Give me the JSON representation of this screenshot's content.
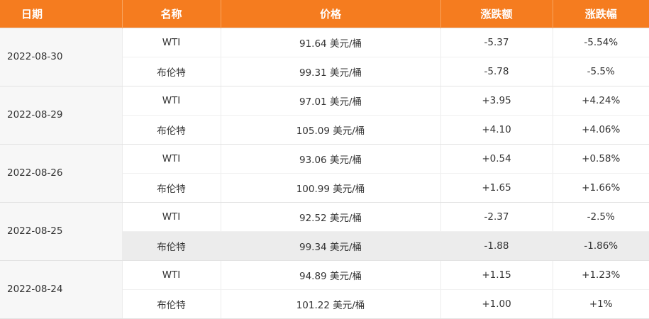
{
  "header": {
    "date": "日期",
    "name": "名称",
    "price": "价格",
    "change": "涨跌额",
    "change_pct": "涨跌幅"
  },
  "rows": [
    {
      "date": "2022-08-30",
      "items": [
        {
          "name": "WTI",
          "price": "91.64 美元/桶",
          "change": "-5.37",
          "change_pct": "-5.54%"
        },
        {
          "name": "布伦特",
          "price": "99.31 美元/桶",
          "change": "-5.78",
          "change_pct": "-5.5%"
        }
      ]
    },
    {
      "date": "2022-08-29",
      "items": [
        {
          "name": "WTI",
          "price": "97.01 美元/桶",
          "change": "+3.95",
          "change_pct": "+4.24%"
        },
        {
          "name": "布伦特",
          "price": "105.09 美元/桶",
          "change": "+4.10",
          "change_pct": "+4.06%"
        }
      ]
    },
    {
      "date": "2022-08-26",
      "items": [
        {
          "name": "WTI",
          "price": "93.06 美元/桶",
          "change": "+0.54",
          "change_pct": "+0.58%"
        },
        {
          "name": "布伦特",
          "price": "100.99 美元/桶",
          "change": "+1.65",
          "change_pct": "+1.66%"
        }
      ]
    },
    {
      "date": "2022-08-25",
      "items": [
        {
          "name": "WTI",
          "price": "92.52 美元/桶",
          "change": "-2.37",
          "change_pct": "-2.5%"
        },
        {
          "name": "布伦特",
          "price": "99.34 美元/桶",
          "change": "-1.88",
          "change_pct": "-1.86%"
        }
      ]
    },
    {
      "date": "2022-08-24",
      "items": [
        {
          "name": "WTI",
          "price": "94.89 美元/桶",
          "change": "+1.15",
          "change_pct": "+1.23%"
        },
        {
          "name": "布伦特",
          "price": "101.22 美元/桶",
          "change": "+1.00",
          "change_pct": "+1%"
        }
      ]
    }
  ],
  "highlighted": {
    "row": 3,
    "item": 1
  },
  "colors": {
    "header_bg": "#f57c1f",
    "header_text": "#ffffff",
    "highlight_bg": "#ececec"
  }
}
